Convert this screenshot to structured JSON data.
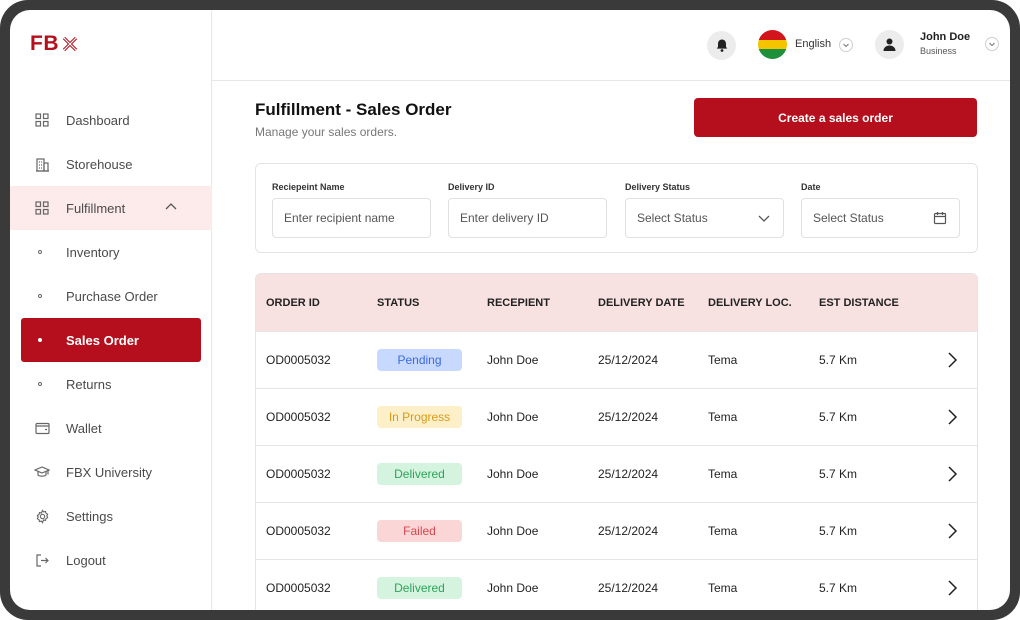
{
  "brand": {
    "logo_text": "FB"
  },
  "sidebar": {
    "items": [
      {
        "label": "Dashboard",
        "icon": "grid-icon"
      },
      {
        "label": "Storehouse",
        "icon": "building-icon"
      },
      {
        "label": "Fulfillment",
        "icon": "grid-icon"
      },
      {
        "label": "Inventory"
      },
      {
        "label": "Purchase Order"
      },
      {
        "label": "Sales Order"
      },
      {
        "label": "Returns"
      },
      {
        "label": "Wallet",
        "icon": "wallet-icon"
      },
      {
        "label": "FBX University",
        "icon": "graduation-cap-icon"
      },
      {
        "label": "Settings",
        "icon": "gear-icon"
      },
      {
        "label": "Logout",
        "icon": "logout-icon"
      }
    ]
  },
  "topbar": {
    "language": "English",
    "user_name": "John Doe",
    "user_role": "Business",
    "flag_colors": [
      "#d2151c",
      "#f5c400",
      "#1e8f3a"
    ]
  },
  "page": {
    "title": "Fulfillment - Sales Order",
    "subtitle": "Manage your sales orders.",
    "create_label": "Create a sales order"
  },
  "filters": {
    "recipient": {
      "label": "Reciepeint Name",
      "placeholder": "Enter recipient name"
    },
    "delivery_id": {
      "label": "Delivery ID",
      "placeholder": "Enter delivery ID"
    },
    "status": {
      "label": "Delivery Status",
      "value": "Select Status"
    },
    "date": {
      "label": "Date",
      "value": "Select Status"
    }
  },
  "table": {
    "headers": [
      "ORDER ID",
      "STATUS",
      "RECEPIENT",
      "DELIVERY DATE",
      "DELIVERY LOC.",
      "EST DISTANCE"
    ],
    "rows": [
      {
        "order_id": "OD0005032",
        "status": "Pending",
        "recipient": "John Doe",
        "date": "25/12/2024",
        "location": "Tema",
        "distance": "5.7 Km"
      },
      {
        "order_id": "OD0005032",
        "status": "In Progress",
        "recipient": "John Doe",
        "date": "25/12/2024",
        "location": "Tema",
        "distance": "5.7 Km"
      },
      {
        "order_id": "OD0005032",
        "status": "Delivered",
        "recipient": "John Doe",
        "date": "25/12/2024",
        "location": "Tema",
        "distance": "5.7 Km"
      },
      {
        "order_id": "OD0005032",
        "status": "Failed",
        "recipient": "John Doe",
        "date": "25/12/2024",
        "location": "Tema",
        "distance": "5.7 Km"
      },
      {
        "order_id": "OD0005032",
        "status": "Delivered",
        "recipient": "John Doe",
        "date": "25/12/2024",
        "location": "Tema",
        "distance": "5.7 Km"
      }
    ]
  },
  "colors": {
    "accent": "#b50e1c",
    "accent_light": "#fdeaea",
    "table_header": "#f8e1e1"
  }
}
